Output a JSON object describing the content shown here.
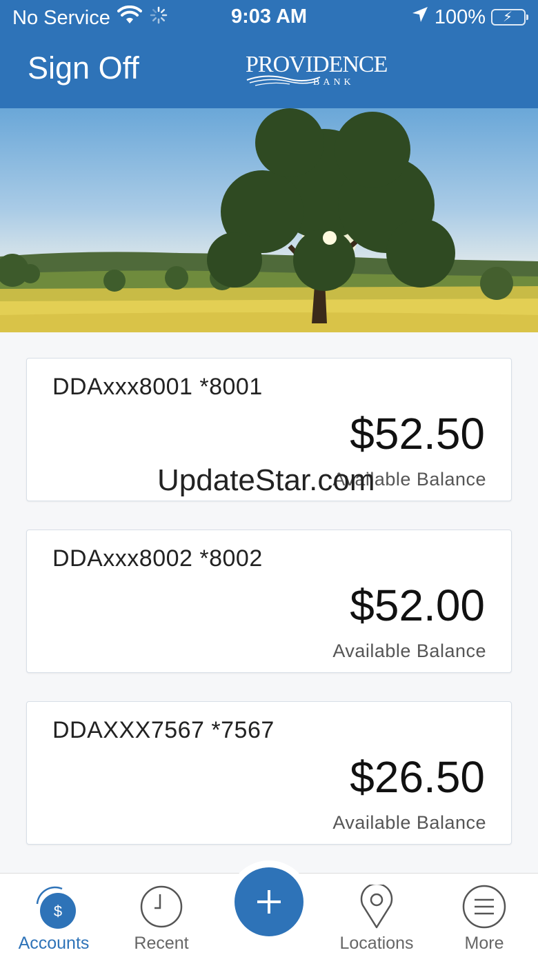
{
  "status_bar": {
    "carrier": "No Service",
    "time": "9:03 AM",
    "battery": "100%"
  },
  "header": {
    "sign_off_label": "Sign Off",
    "brand_name": "PROVIDENCE",
    "brand_sub": "BANK"
  },
  "accounts": [
    {
      "name": "DDAxxx8001 *8001",
      "amount": "$52.50",
      "label": "Available Balance"
    },
    {
      "name": "DDAxxx8002 *8002",
      "amount": "$52.00",
      "label": "Available Balance"
    },
    {
      "name": "DDAXXX7567 *7567",
      "amount": "$26.50",
      "label": "Available Balance"
    }
  ],
  "watermark": "UpdateStar.com",
  "tabbar": {
    "accounts_label": "Accounts",
    "accounts_glyph": "$",
    "recent_label": "Recent",
    "locations_label": "Locations",
    "more_label": "More"
  },
  "colors": {
    "primary": "#2e73b8",
    "battery_green": "#4cd964"
  }
}
